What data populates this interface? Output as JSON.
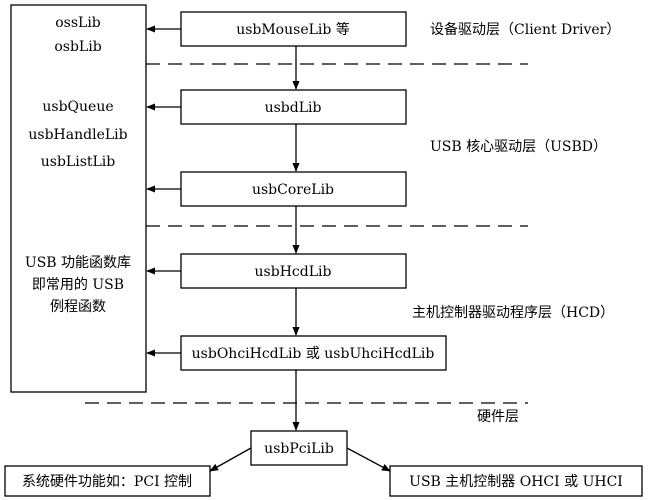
{
  "left_panel": {
    "lines": [
      "ossLib",
      "osbLib",
      "usbQueue",
      "usbHandleLib",
      "usbListLib",
      "USB 功能函数库",
      "即常用的 USB",
      "例程函数"
    ]
  },
  "boxes": {
    "mouse": "usbMouseLib 等",
    "usbd": "usbdLib",
    "core": "usbCoreLib",
    "hcd": "usbHcdLib",
    "ohci": "usbOhciHcdLib 或 usbUhciHcdLib",
    "pci": "usbPciLib",
    "system": "系统硬件功能如：PCI 控制",
    "controller": "USB 主机控制器 OHCI 或 UHCI"
  },
  "layers": {
    "client": "设备驱动层（Client Driver）",
    "usbd": "USB 核心驱动层（USBD）",
    "hcd": "主机控制器驱动程序层（HCD）",
    "hardware": "硬件层"
  }
}
